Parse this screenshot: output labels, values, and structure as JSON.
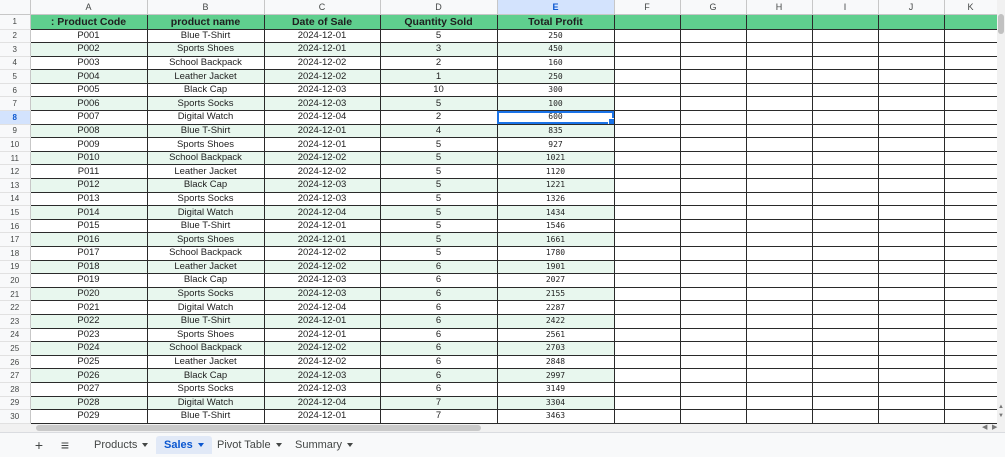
{
  "columns": [
    "A",
    "B",
    "C",
    "D",
    "E",
    "F",
    "G",
    "H",
    "I",
    "J",
    "K"
  ],
  "selected_column": "E",
  "selected_row": 8,
  "active_cell": "E8",
  "header": [
    "Product Code",
    "product name",
    "Date of Sale",
    "Quantity Sold",
    "Total Profit"
  ],
  "header_prefix": ": ",
  "rows": [
    [
      "P001",
      "Blue T-Shirt",
      "2024-12-01",
      "5",
      "250"
    ],
    [
      "P002",
      "Sports Shoes",
      "2024-12-01",
      "3",
      "450"
    ],
    [
      "P003",
      "School Backpack",
      "2024-12-02",
      "2",
      "160"
    ],
    [
      "P004",
      "Leather Jacket",
      "2024-12-02",
      "1",
      "250"
    ],
    [
      "P005",
      "Black Cap",
      "2024-12-03",
      "10",
      "300"
    ],
    [
      "P006",
      "Sports Socks",
      "2024-12-03",
      "5",
      "100"
    ],
    [
      "P007",
      "Digital Watch",
      "2024-12-04",
      "2",
      "600"
    ],
    [
      "P008",
      "Blue T-Shirt",
      "2024-12-01",
      "4",
      "835"
    ],
    [
      "P009",
      "Sports Shoes",
      "2024-12-01",
      "5",
      "927"
    ],
    [
      "P010",
      "School Backpack",
      "2024-12-02",
      "5",
      "1021"
    ],
    [
      "P011",
      "Leather Jacket",
      "2024-12-02",
      "5",
      "1120"
    ],
    [
      "P012",
      "Black Cap",
      "2024-12-03",
      "5",
      "1221"
    ],
    [
      "P013",
      "Sports Socks",
      "2024-12-03",
      "5",
      "1326"
    ],
    [
      "P014",
      "Digital Watch",
      "2024-12-04",
      "5",
      "1434"
    ],
    [
      "P015",
      "Blue T-Shirt",
      "2024-12-01",
      "5",
      "1546"
    ],
    [
      "P016",
      "Sports Shoes",
      "2024-12-01",
      "5",
      "1661"
    ],
    [
      "P017",
      "School Backpack",
      "2024-12-02",
      "5",
      "1780"
    ],
    [
      "P018",
      "Leather Jacket",
      "2024-12-02",
      "6",
      "1901"
    ],
    [
      "P019",
      "Black Cap",
      "2024-12-03",
      "6",
      "2027"
    ],
    [
      "P020",
      "Sports Socks",
      "2024-12-03",
      "6",
      "2155"
    ],
    [
      "P021",
      "Digital Watch",
      "2024-12-04",
      "6",
      "2287"
    ],
    [
      "P022",
      "Blue T-Shirt",
      "2024-12-01",
      "6",
      "2422"
    ],
    [
      "P023",
      "Sports Shoes",
      "2024-12-01",
      "6",
      "2561"
    ],
    [
      "P024",
      "School Backpack",
      "2024-12-02",
      "6",
      "2703"
    ],
    [
      "P025",
      "Leather Jacket",
      "2024-12-02",
      "6",
      "2848"
    ],
    [
      "P026",
      "Black Cap",
      "2024-12-03",
      "6",
      "2997"
    ],
    [
      "P027",
      "Sports Socks",
      "2024-12-03",
      "6",
      "3149"
    ],
    [
      "P028",
      "Digital Watch",
      "2024-12-04",
      "7",
      "3304"
    ],
    [
      "P029",
      "Blue T-Shirt",
      "2024-12-01",
      "7",
      "3463"
    ]
  ],
  "tabs": [
    {
      "label": "Products",
      "active": false
    },
    {
      "label": "Sales",
      "active": true
    },
    {
      "label": "Pivot Table",
      "active": false
    },
    {
      "label": "Summary",
      "active": false
    }
  ],
  "icons": {
    "add_sheet": "+",
    "all_sheets": "≡"
  },
  "colors": {
    "header_green": "#5fcf8e",
    "row_band": "#e8f7ee",
    "selection_blue": "#1a73e8"
  }
}
